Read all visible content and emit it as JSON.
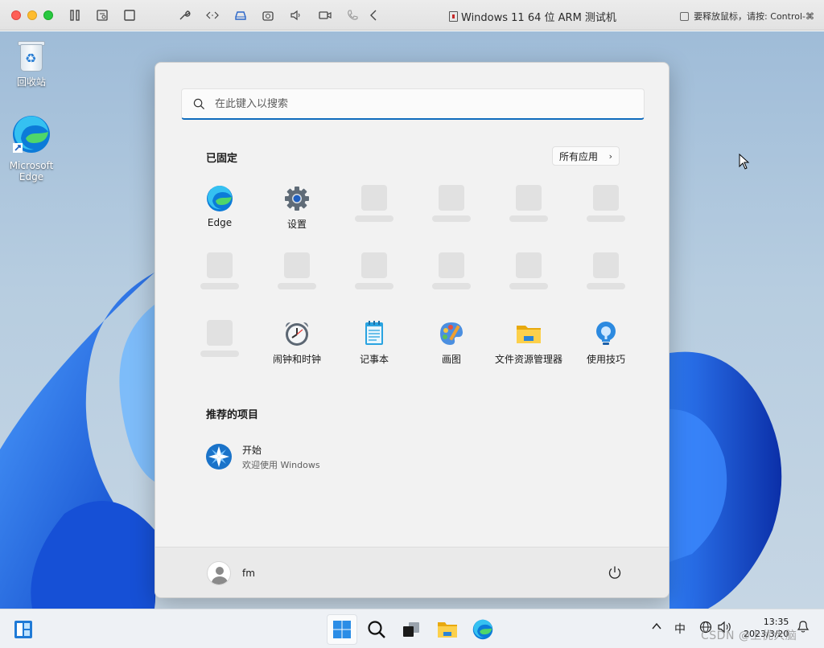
{
  "mac_window": {
    "title": "Windows 11 64 位 ARM 测试机",
    "release_hint": "要释放鼠标，请按: Control-⌘",
    "toolbar_icons": [
      "pause-icon",
      "settings-panel-icon",
      "window-icon",
      "wrench-icon",
      "code-arrows-icon",
      "drive-icon",
      "camera-icon",
      "speaker-icon",
      "video-icon",
      "phone-icon",
      "back-icon"
    ]
  },
  "desktop": {
    "icons": [
      {
        "label": "回收站",
        "icon": "recycle-bin-icon"
      },
      {
        "label": "Microsoft Edge",
        "icon": "edge-icon"
      }
    ]
  },
  "start_menu": {
    "search_placeholder": "在此键入以搜索",
    "pinned_title": "已固定",
    "all_apps_label": "所有应用",
    "pinned": [
      {
        "label": "Edge",
        "icon": "edge-icon"
      },
      {
        "label": "设置",
        "icon": "settings-gear-icon"
      },
      {
        "label": "闹钟和时钟",
        "icon": "alarm-clock-icon"
      },
      {
        "label": "记事本",
        "icon": "notepad-icon"
      },
      {
        "label": "画图",
        "icon": "paint-palette-icon"
      },
      {
        "label": "文件资源管理器",
        "icon": "file-explorer-icon"
      },
      {
        "label": "使用技巧",
        "icon": "tips-lightbulb-icon"
      }
    ],
    "recommended_title": "推荐的项目",
    "recommended": [
      {
        "title": "开始",
        "subtitle": "欢迎使用 Windows",
        "icon": "get-started-icon"
      }
    ],
    "user_name": "fm"
  },
  "taskbar": {
    "apps": [
      "widgets-icon",
      "start-icon",
      "search-icon",
      "task-view-icon",
      "file-explorer-icon",
      "edge-icon"
    ],
    "tray": {
      "ime": "中",
      "time": "13:35",
      "date": "2023/3/20"
    }
  },
  "watermark": "CSDN @上优大脑",
  "colors": {
    "accent": "#0f6cbd",
    "start_bg": "#f2f2f2",
    "bloom": "#1b5fe0"
  }
}
